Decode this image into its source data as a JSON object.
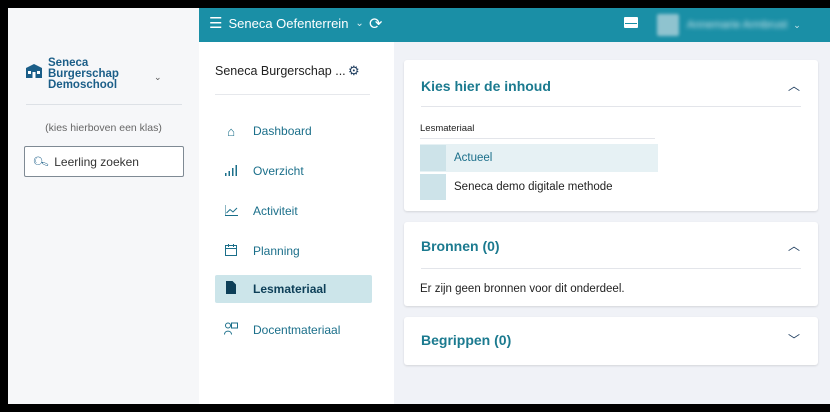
{
  "topbar": {
    "school_menu_label": "Seneca Oefenterrein",
    "user_name": "Annemarie Armbrust"
  },
  "sidebar": {
    "logo_lines": [
      "Seneca",
      "Burgerschap",
      "Demoschool"
    ],
    "hint": "(kies hierboven een klas)",
    "search_placeholder": "Leerling zoeken"
  },
  "course_nav": {
    "title": "Seneca Burgerschap ...",
    "items": [
      {
        "label": "Dashboard",
        "icon": "home-icon"
      },
      {
        "label": "Overzicht",
        "icon": "bar-chart-icon"
      },
      {
        "label": "Activiteit",
        "icon": "line-chart-icon"
      },
      {
        "label": "Planning",
        "icon": "calendar-icon"
      },
      {
        "label": "Lesmateriaal",
        "icon": "document-icon",
        "active": true
      },
      {
        "label": "Docentmateriaal",
        "icon": "teacher-icon"
      }
    ]
  },
  "content": {
    "card1": {
      "title": "Kies hier de inhoud",
      "section_label": "Lesmateriaal",
      "items": [
        "Actueel",
        "Seneca demo digitale methode"
      ]
    },
    "card2": {
      "title": "Bronnen (0)",
      "empty_text": "Er zijn geen bronnen voor dit onderdeel."
    },
    "card3": {
      "title": "Begrippen (0)"
    }
  },
  "colors": {
    "topbar": "#1a8fa6",
    "accent": "#1b7a8f",
    "active_nav": "#cce5ea",
    "background": "#f0f2f7"
  }
}
